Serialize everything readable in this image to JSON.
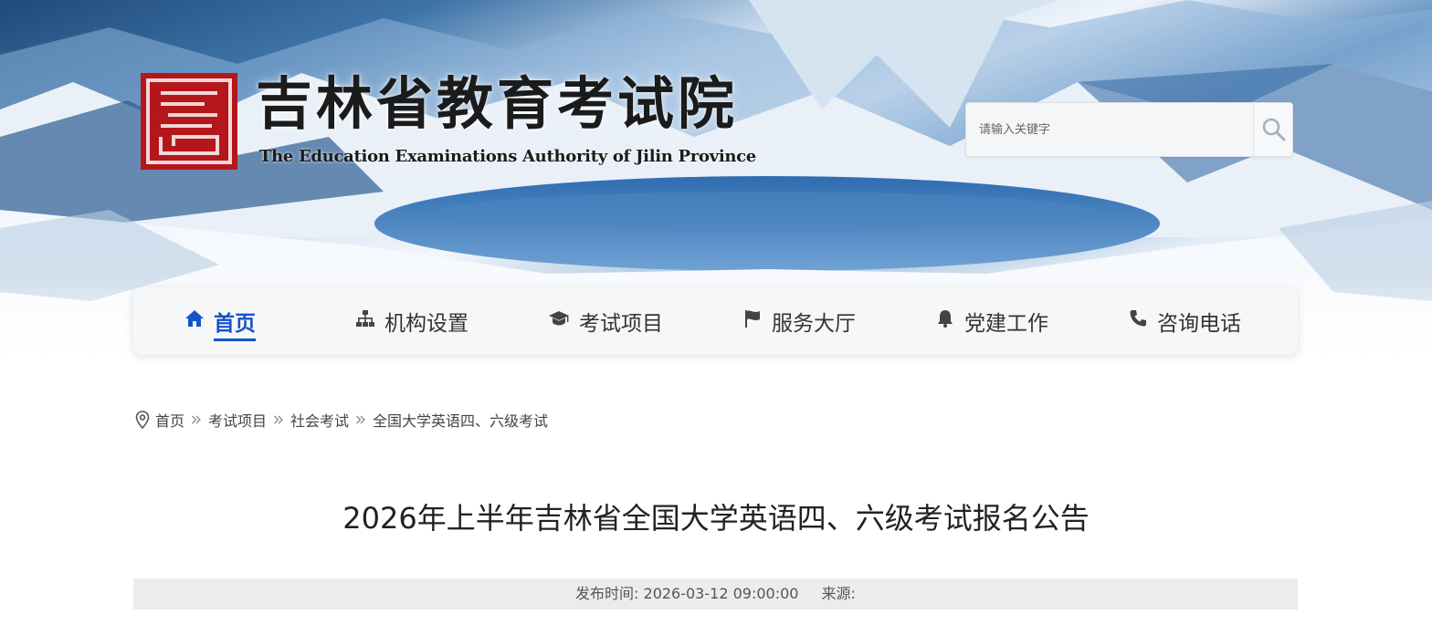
{
  "header": {
    "site_title": "吉林省教育考试院",
    "site_subtitle": "The Education Examinations Authority of Jilin Province",
    "logo_seal_text": "吉"
  },
  "search": {
    "placeholder": "请输入关键字",
    "value": ""
  },
  "nav": {
    "items": [
      {
        "label": "首页",
        "icon": "home-icon",
        "active": true
      },
      {
        "label": "机构设置",
        "icon": "org-chart-icon"
      },
      {
        "label": "考试项目",
        "icon": "graduation-cap-icon"
      },
      {
        "label": "服务大厅",
        "icon": "flag-icon"
      },
      {
        "label": "党建工作",
        "icon": "bell-icon"
      },
      {
        "label": "咨询电话",
        "icon": "phone-icon"
      }
    ]
  },
  "breadcrumb": {
    "icon": "location-pin-icon",
    "items": [
      "首页",
      "考试项目",
      "社会考试",
      "全国大学英语四、六级考试"
    ]
  },
  "article": {
    "title": "2026年上半年吉林省全国大学英语四、六级考试报名公告",
    "publish_label": "发布时间: 2026-03-12 09:00:00",
    "source_label": "来源:"
  },
  "colors": {
    "accent": "#1553c9",
    "seal_red": "#b3171b",
    "meta_bg": "#ececec"
  }
}
